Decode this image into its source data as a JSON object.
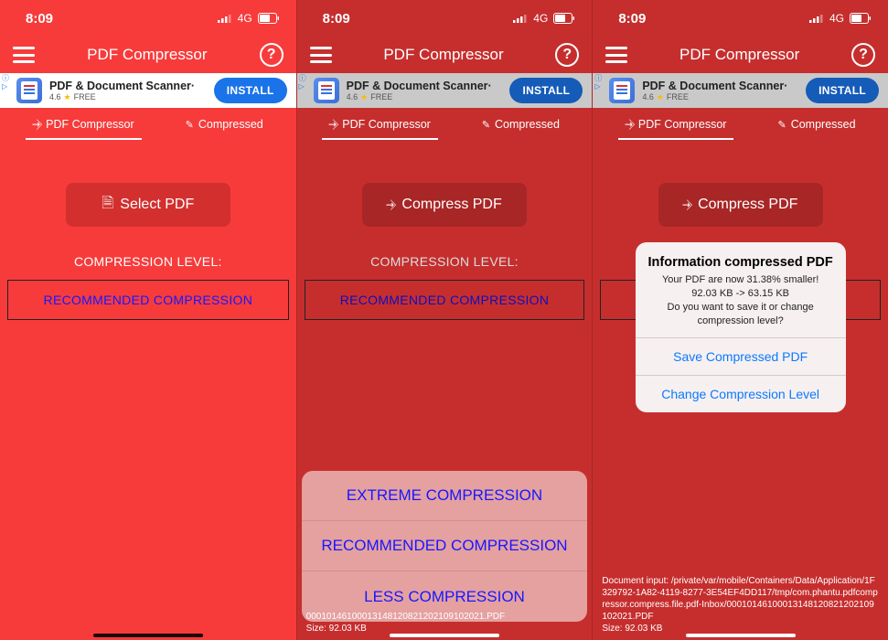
{
  "status": {
    "time": "8:09",
    "network": "4G"
  },
  "header": {
    "title": "PDF Compressor",
    "help": "?"
  },
  "ad": {
    "title": "PDF & Document Scanner·",
    "rating": "4.6",
    "free": "FREE",
    "cta": "INSTALL"
  },
  "tabs": {
    "compressor": "PDF Compressor",
    "compressed": "Compressed"
  },
  "screen1": {
    "button": "Select PDF",
    "label": "COMPRESSION LEVEL:",
    "rec": "RECOMMENDED COMPRESSION"
  },
  "screen2": {
    "button": "Compress PDF",
    "label": "COMPRESSION LEVEL:",
    "rec": "RECOMMENDED COMPRESSION",
    "sheet": {
      "extreme": "EXTREME COMPRESSION",
      "recommended": "RECOMMENDED COMPRESSION",
      "less": "LESS COMPRESSION"
    },
    "bottom_line1": "00010146100013148120821202109102021.PDF",
    "bottom_line2": "Size: 92.03 KB"
  },
  "screen3": {
    "button": "Compress PDF",
    "alert": {
      "title": "Information compressed PDF",
      "line1": "Your PDF are now 31.38% smaller!",
      "line2": "92.03 KB -> 63.15 KB",
      "line3": "Do you want to save it or change compression level?",
      "save": "Save Compressed PDF",
      "change": "Change Compression Level"
    },
    "bottom": "Document input: /private/var/mobile/Containers/Data/Application/1F329792-1A82-4119-8277-3E54EF4DD117/tmp/com.phantu.pdfcompressor.compress.file.pdf-Inbox/00010146100013148120821202109102021.PDF\nSize: 92.03 KB"
  }
}
